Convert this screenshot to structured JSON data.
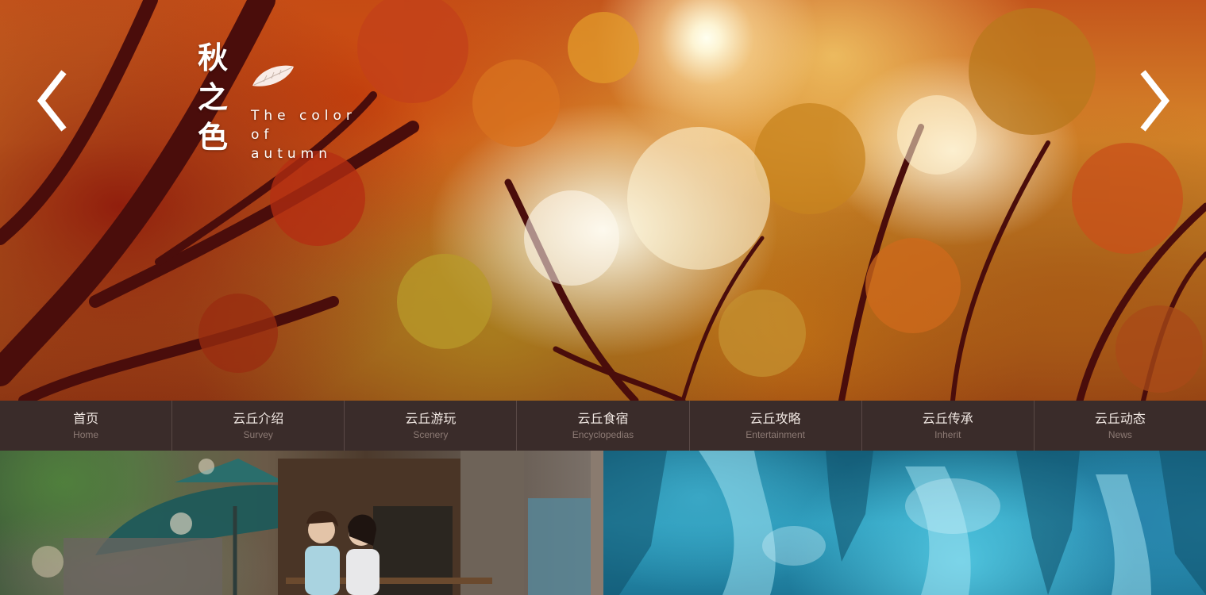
{
  "hero": {
    "title_cn": [
      "秋",
      "之",
      "色"
    ],
    "title_en": [
      "The color",
      "of",
      "autumn"
    ],
    "prev_arrow": "chevron-left-icon",
    "next_arrow": "chevron-right-icon",
    "leaf_icon": "leaf-icon"
  },
  "nav": {
    "items": [
      {
        "cn": "首页",
        "en": "Home"
      },
      {
        "cn": "云丘介绍",
        "en": "Survey"
      },
      {
        "cn": "云丘游玩",
        "en": "Scenery"
      },
      {
        "cn": "云丘食宿",
        "en": "Encyclopedias"
      },
      {
        "cn": "云丘攻略",
        "en": "Entertainment"
      },
      {
        "cn": "云丘传承",
        "en": "Inherit"
      },
      {
        "cn": "云丘动态",
        "en": "News"
      }
    ]
  },
  "colors": {
    "nav_background": "#3a2c2a",
    "nav_text": "#f1e8e3",
    "nav_subtext": "#8c7a74",
    "divider": "#8a7b6f"
  }
}
